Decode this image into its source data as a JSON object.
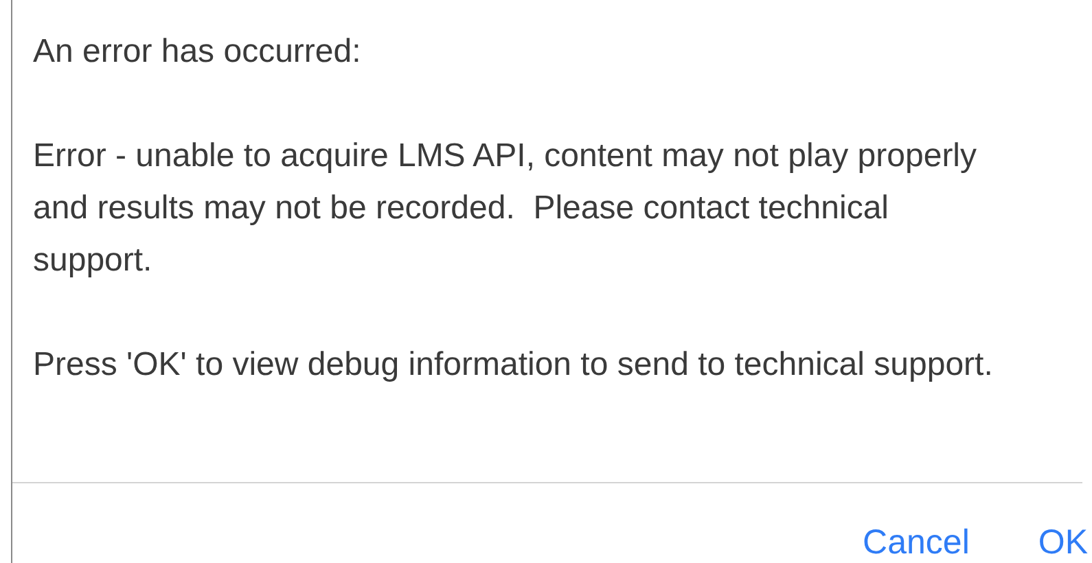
{
  "dialog": {
    "heading": "An error has occurred:",
    "paragraphs": [
      "Error - unable to acquire LMS API, content may not play properly and results may not be recorded.  Please contact technical support.",
      "Press 'OK' to view debug information to send to technical support."
    ],
    "buttons": [
      {
        "label": "Cancel",
        "kind": "secondary"
      },
      {
        "label": "OK",
        "kind": "primary"
      }
    ]
  }
}
